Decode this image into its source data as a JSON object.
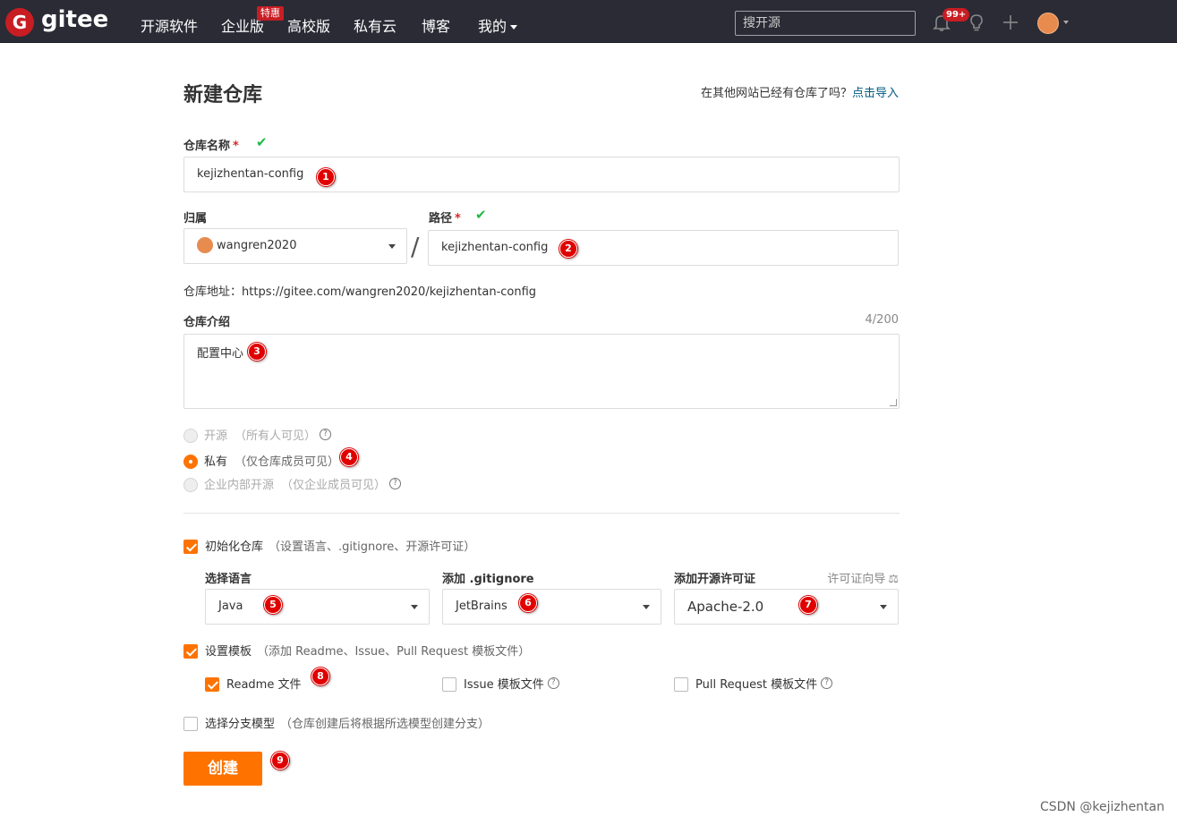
{
  "nav": {
    "logo_letter": "G",
    "logo_text": "gitee",
    "items": [
      "开源软件",
      "企业版",
      "高校版",
      "私有云",
      "博客",
      "我的"
    ],
    "enterprise_badge": "特惠",
    "search_placeholder": "搜开源",
    "notifications_badge": "99+",
    "icons": [
      "bell-icon",
      "lightbulb-icon",
      "plus-icon",
      "avatar"
    ]
  },
  "page": {
    "title": "新建仓库",
    "import_hint": "在其他网站已经有仓库了吗？",
    "import_link": "点击导入"
  },
  "form": {
    "repo_name_label": "仓库名称",
    "required_mark": "*",
    "repo_name_value": "kejizhentan-config",
    "owner_label": "归属",
    "owner_value": "wangren2020",
    "path_label": "路径",
    "path_separator": "/",
    "path_value": "kejizhentan-config",
    "repo_url_prefix": "仓库地址：",
    "repo_url": "https://gitee.com/wangren2020/kejizhentan-config",
    "desc_label": "仓库介绍",
    "desc_counter": "4/200",
    "desc_value": "配置中心",
    "visibility": [
      {
        "label": "开源",
        "sub": "（所有人可见）",
        "selected": false,
        "disabled": true,
        "help": true
      },
      {
        "label": "私有",
        "sub": "（仅仓库成员可见）",
        "selected": true,
        "disabled": false,
        "help": false
      },
      {
        "label": "企业内部开源",
        "sub": "（仅企业成员可见）",
        "selected": false,
        "disabled": true,
        "help": true
      }
    ],
    "init_repo": {
      "label": "初始化仓库",
      "sub": "（设置语言、.gitignore、开源许可证）",
      "checked": true
    },
    "language_label": "选择语言",
    "language_value": "Java",
    "gitignore_label": "添加 .gitignore",
    "gitignore_value": "JetBrains",
    "license_label": "添加开源许可证",
    "license_guide": "许可证向导",
    "license_value": "Apache-2.0",
    "template": {
      "label": "设置模板",
      "sub": "（添加 Readme、Issue、Pull Request 模板文件）",
      "checked": true
    },
    "readme": {
      "label": "Readme 文件",
      "checked": true
    },
    "issue_tpl": {
      "label": "Issue 模板文件",
      "checked": false
    },
    "pr_tpl": {
      "label": "Pull Request 模板文件",
      "checked": false
    },
    "branch_model": {
      "label": "选择分支模型",
      "sub": "（仓库创建后将根据所选模型创建分支）",
      "checked": false
    },
    "create_button": "创建"
  },
  "markers": [
    "1",
    "2",
    "3",
    "4",
    "5",
    "6",
    "7",
    "8",
    "9"
  ],
  "help_glyph": "?",
  "watermark": "CSDN @kejizhentan",
  "colors": {
    "nav_bg": "#2a2b35",
    "brand_red": "#c71d23",
    "accent_orange": "#fe7300",
    "link": "#005980",
    "ok_green": "#21ba45"
  }
}
